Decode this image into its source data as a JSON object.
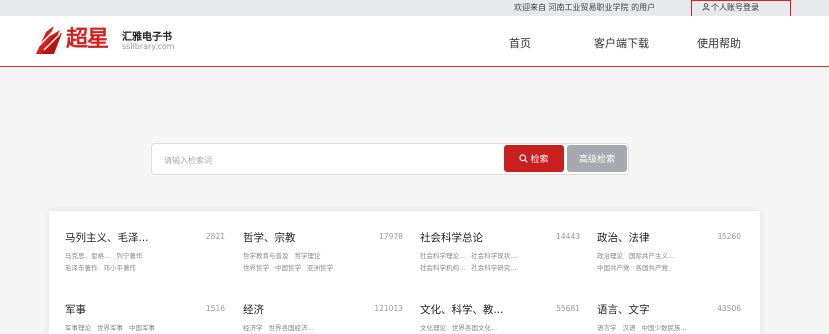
{
  "topbar": {
    "welcome": "欢迎来自 河南工业贸易职业学院 的用户",
    "login": "个人账号登录"
  },
  "header": {
    "logo_text": "超星",
    "brand_name": "汇雅电子书",
    "brand_domain": "sslibrary.com",
    "nav": [
      "首页",
      "客户端下载",
      "使用帮助"
    ]
  },
  "search": {
    "placeholder": "请输入检索词",
    "value": "",
    "search_label": "检索",
    "advanced_label": "高级检索"
  },
  "categories": [
    {
      "title": "马列主义、毛泽...",
      "count": "2821",
      "line1": [
        "马克思、恩格...",
        "列宁著作"
      ],
      "line2": [
        "毛泽东著作",
        "邓小平著作"
      ]
    },
    {
      "title": "哲学、宗教",
      "count": "17978",
      "line1": [
        "哲学教育与普及",
        "哲学理论"
      ],
      "line2": [
        "世界哲学",
        "中国哲学",
        "亚洲哲学"
      ]
    },
    {
      "title": "社会科学总论",
      "count": "14443",
      "line1": [
        "社会科学理论...",
        "社会科学现状..."
      ],
      "line2": [
        "社会科学机构...",
        "社会科学研究..."
      ]
    },
    {
      "title": "政治、法律",
      "count": "35260",
      "line1": [
        "政治理论",
        "国际共产主义..."
      ],
      "line2": [
        "中国共产党",
        "各国共产党"
      ]
    },
    {
      "title": "军事",
      "count": "1516",
      "line1": [
        "军事理论",
        "世界军事",
        "中国军事"
      ],
      "line2": []
    },
    {
      "title": "经济",
      "count": "121013",
      "line1": [
        "经济学",
        "世界各国经济..."
      ],
      "line2": []
    },
    {
      "title": "文化、科学、教...",
      "count": "55681",
      "line1": [
        "文化理论",
        "世界各国文化..."
      ],
      "line2": []
    },
    {
      "title": "语言、文字",
      "count": "43506",
      "line1": [
        "语言学",
        "汉语",
        "中国少数民族..."
      ],
      "line2": []
    }
  ],
  "colors": {
    "brand_red": "#c81f1f",
    "advanced_gray": "#a7a8b0",
    "highlight_box": "#e0201c"
  }
}
